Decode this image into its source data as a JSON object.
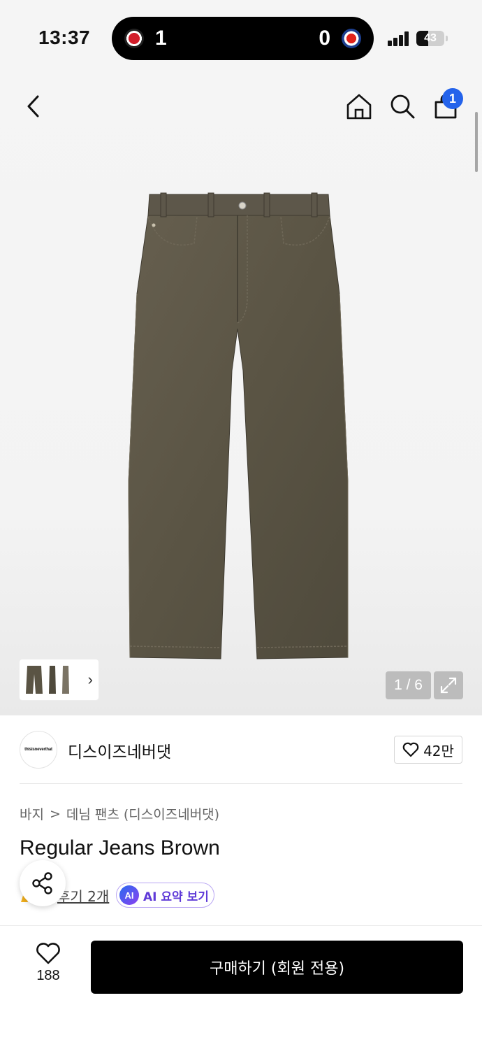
{
  "status_bar": {
    "time": "13:37",
    "score_left": "1",
    "score_right": "0",
    "battery": "43",
    "battery_level": 0.43
  },
  "nav": {
    "cart_count": "1"
  },
  "gallery": {
    "counter": "1 / 6",
    "current": 1,
    "total": 6
  },
  "brand": {
    "logo_text": "thisisneverthat",
    "name": "디스이즈네버댓",
    "likes": "42만"
  },
  "breadcrumb": {
    "category": "바지",
    "separator": ">",
    "subcategory": "데님 팬츠 (디스이즈네버댓)"
  },
  "product": {
    "title": "Regular Jeans Brown",
    "review_link": "후기 2개",
    "ai_badge": "AI",
    "ai_summary": "AI 요약 보기"
  },
  "bottom_bar": {
    "wish_count": "188",
    "buy_label": "구매하기 (회원 전용)"
  },
  "colors": {
    "accent_blue": "#2463eb",
    "ai_purple": "#5f3ad8",
    "denim_brown": "#5a5444",
    "buy_button": "#000000"
  }
}
